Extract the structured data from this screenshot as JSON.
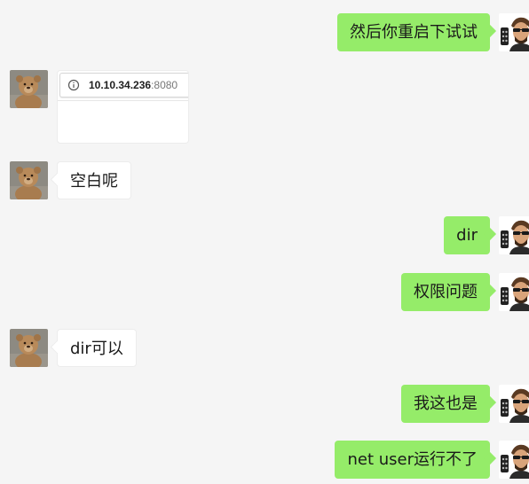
{
  "colors": {
    "background": "#f5f5f5",
    "incoming_bubble": "#ffffff",
    "outgoing_bubble": "#95ec69",
    "text": "#1a1a1a"
  },
  "contacts": {
    "self_avatar": "cartoon-sunglasses-avatar",
    "other_avatar": "teddy-bear-avatar"
  },
  "messages": [
    {
      "direction": "out",
      "type": "text",
      "text": "然后你重启下试试"
    },
    {
      "direction": "in",
      "type": "image",
      "url_host": "10.10.34.236",
      "url_port": ":8080"
    },
    {
      "direction": "in",
      "type": "text",
      "text": "空白呢"
    },
    {
      "direction": "out",
      "type": "text",
      "text": "dir"
    },
    {
      "direction": "out",
      "type": "text",
      "text": "权限问题"
    },
    {
      "direction": "in",
      "type": "text",
      "text": "dir可以"
    },
    {
      "direction": "out",
      "type": "text",
      "text": "我这也是"
    },
    {
      "direction": "out",
      "type": "text",
      "text": "net user运行不了"
    }
  ]
}
